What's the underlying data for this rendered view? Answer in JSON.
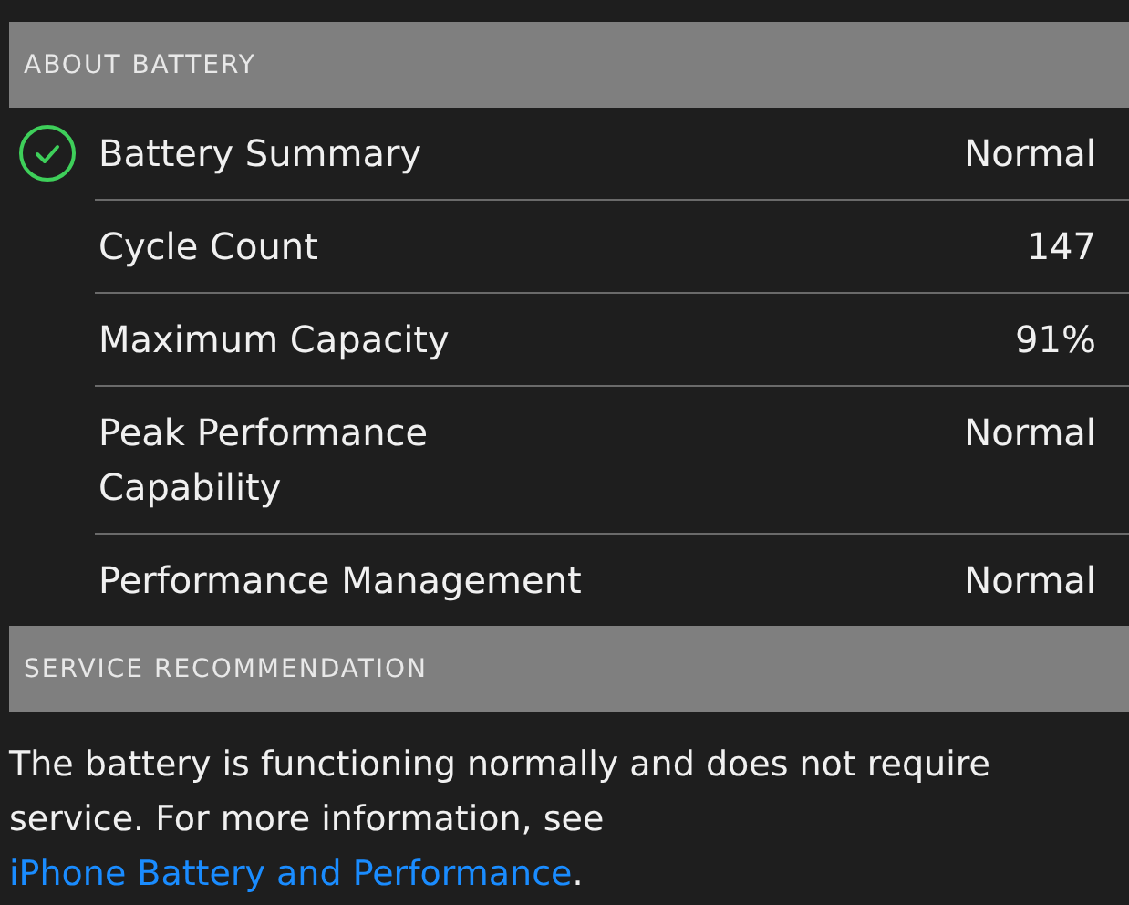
{
  "sections": [
    {
      "title": "ABOUT BATTERY",
      "rows": [
        {
          "label": "Battery Summary",
          "value": "Normal",
          "checked": true
        },
        {
          "label": "Cycle Count",
          "value": "147",
          "checked": false
        },
        {
          "label": "Maximum Capacity",
          "value": "91%",
          "checked": false
        },
        {
          "label": "Peak Performance Capability",
          "value": "Normal",
          "checked": false
        },
        {
          "label": "Performance Management",
          "value": "Normal",
          "checked": false
        }
      ]
    },
    {
      "title": "SERVICE RECOMMENDATION",
      "text": "The battery is functioning normally and does not require service. For more information, see ",
      "link": "iPhone Battery and Performance",
      "after": "."
    }
  ]
}
